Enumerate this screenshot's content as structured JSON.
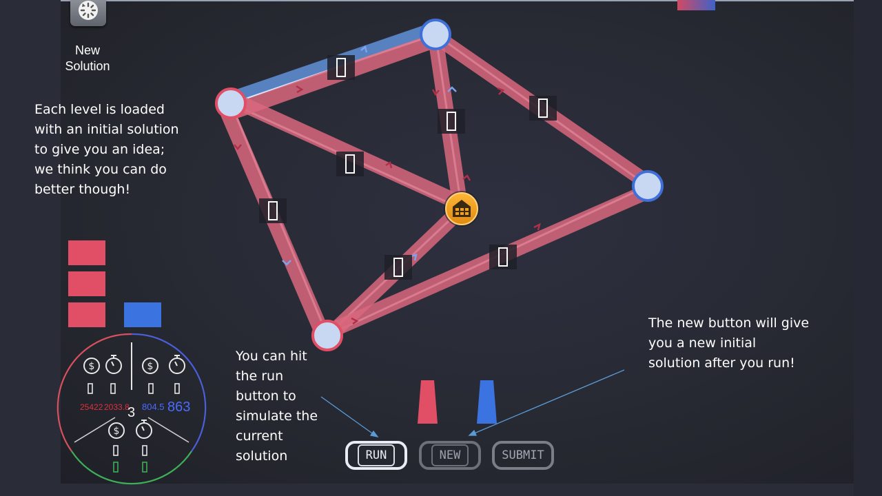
{
  "new_solution": {
    "label": "New\nSolution",
    "icon": "refresh-icon"
  },
  "captions": {
    "intro": "Each level is loaded\nwith an initial solution\nto give you an idea;\nwe think you can do\nbetter though!",
    "run": "You can hit\nthe run\nbutton to\nsimulate the\ncurrent\nsolution",
    "new": "The new button will give\nyou a new initial\nsolution after you run!"
  },
  "buttons": {
    "run": "RUN",
    "new": "NEW",
    "submit": "SUBMIT"
  },
  "stats": {
    "center_value": "3",
    "red_cost": "25422",
    "red_time": "2033.8",
    "blue_cost": "804.5",
    "blue_time": "863",
    "icons": [
      "dollar-icon",
      "stopwatch-icon"
    ]
  },
  "graph": {
    "edge_marker": "0",
    "hub_icon": "warehouse-icon"
  },
  "colors": {
    "red_team": "#e04f66",
    "blue_team": "#3b74e0",
    "route_red": "#d9677d",
    "route_blue": "#5b86c8",
    "hub": "#f2a124",
    "node": "#c9d8f2"
  }
}
